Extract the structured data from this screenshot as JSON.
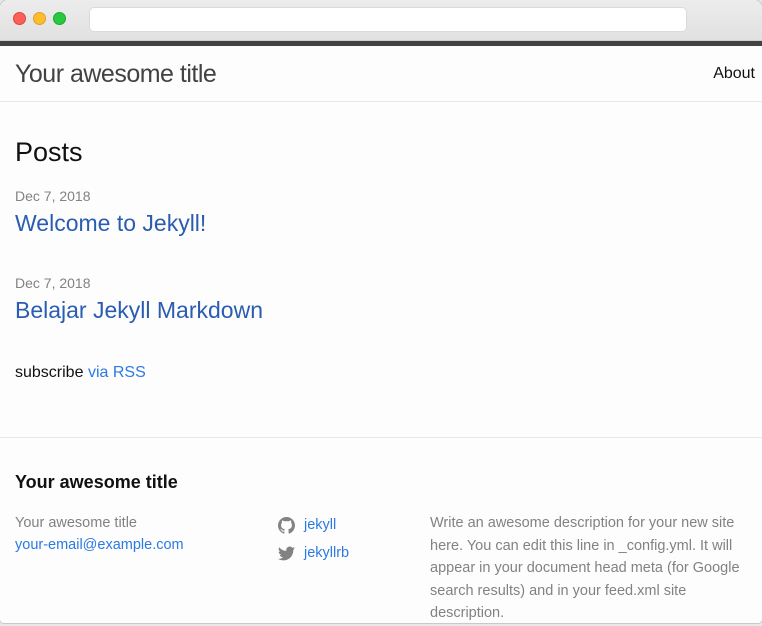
{
  "browser": {
    "url": ""
  },
  "header": {
    "site_title": "Your awesome title",
    "nav": [
      "About"
    ]
  },
  "main": {
    "heading": "Posts",
    "posts": [
      {
        "date": "Dec 7, 2018",
        "title": "Welcome to Jekyll!"
      },
      {
        "date": "Dec 7, 2018",
        "title": "Belajar Jekyll Markdown"
      }
    ],
    "subscribe_prefix": "subscribe",
    "subscribe_link": "via RSS"
  },
  "footer": {
    "heading": "Your awesome title",
    "name": "Your awesome title",
    "email": "your-email@example.com",
    "social": [
      {
        "icon": "github-icon",
        "label": "jekyll"
      },
      {
        "icon": "twitter-icon",
        "label": "jekyllrb"
      }
    ],
    "description": "Write an awesome description for your new site here. You can edit this line in _config.yml. It will appear in your document head meta (for Google search results) and in your feed.xml site description."
  },
  "colors": {
    "link": "#2a7ae2",
    "post_title": "#2a5db0",
    "muted": "#828282",
    "top_border": "#424242"
  }
}
